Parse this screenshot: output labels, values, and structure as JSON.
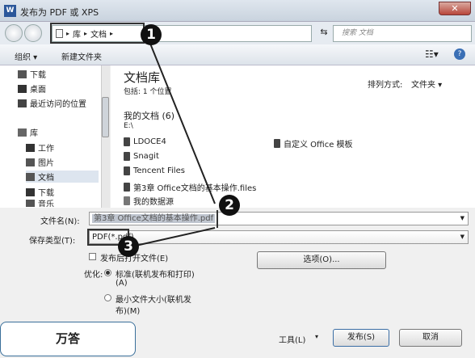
{
  "window": {
    "title": "发布为 PDF 或 XPS",
    "icon": "W",
    "close": "✕"
  },
  "nav": {
    "crumbs": [
      "库",
      "文档"
    ],
    "search_placeholder": "搜索 文档"
  },
  "toolbar": {
    "organize": "组织 ▾",
    "new_folder": "新建文件夹",
    "help": "?"
  },
  "sidebar": {
    "items": [
      "下载",
      "桌面",
      "最近访问的位置",
      "库",
      "工作",
      "图片",
      "文档",
      "下载",
      "音乐"
    ]
  },
  "main": {
    "title": "文档库",
    "subtitle": "包括: 1 个位置",
    "sort_label": "排列方式:",
    "sort_value": "文件夹 ▾",
    "section": "我的文档 (6)",
    "section_sub": "E:\\",
    "folders_left": [
      "LDOCE4",
      "Snagit",
      "Tencent Files",
      "第3章 Office文档的基本操作.files"
    ],
    "folders_right": [
      "自定义 Office 模板"
    ],
    "db": "我的数据源"
  },
  "form": {
    "filename_label": "文件名(N):",
    "filename_value": "第3章 Office文档的基本操作.pdf",
    "type_label": "保存类型(T):",
    "type_value": "PDF(*.pdf)",
    "publish_open": "发布后打开文件(E)",
    "options_button": "选项(O)...",
    "optimize_label": "优化:",
    "opt1_line1": "标准(联机发布和打印)",
    "opt1_line2": "(A)",
    "opt2_line1": "最小文件大小(联机发",
    "opt2_line2": "布)(M)",
    "tools": "工具(L)",
    "tools_arrow": "▾",
    "publish": "发布(S)",
    "cancel": "取消"
  },
  "callouts": [
    "1",
    "2",
    "3"
  ],
  "watermark": "万答"
}
